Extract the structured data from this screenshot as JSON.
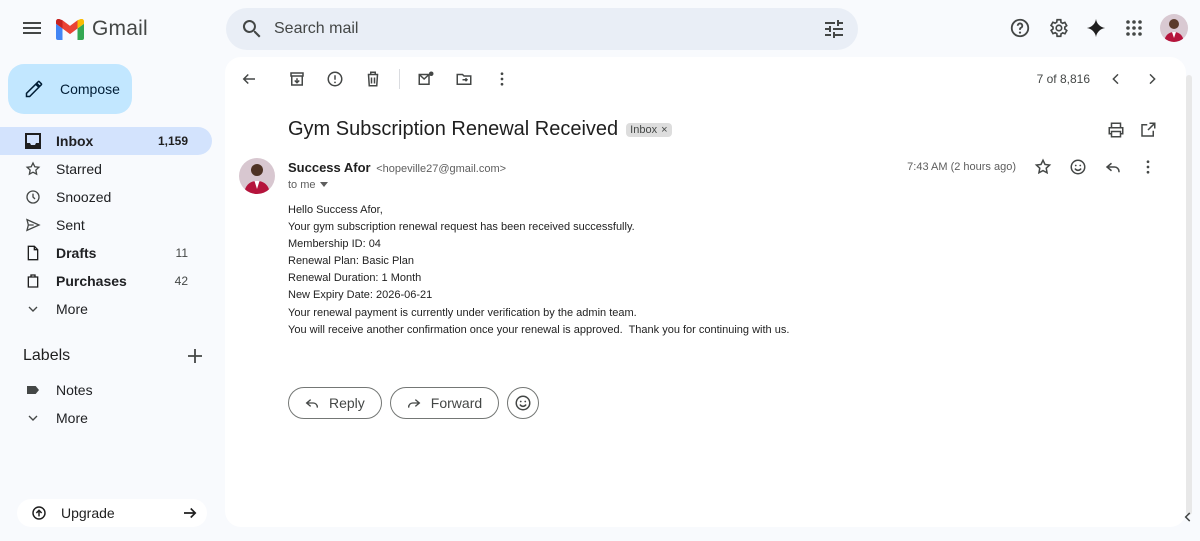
{
  "app": {
    "name": "Gmail",
    "search_placeholder": "Search mail"
  },
  "sidebar": {
    "compose_label": "Compose",
    "items": [
      {
        "label": "Inbox",
        "count": "1,159",
        "icon": "inbox-icon",
        "active": true
      },
      {
        "label": "Starred",
        "count": "",
        "icon": "star-icon"
      },
      {
        "label": "Snoozed",
        "count": "",
        "icon": "clock-icon"
      },
      {
        "label": "Sent",
        "count": "",
        "icon": "send-icon"
      },
      {
        "label": "Drafts",
        "count": "11",
        "icon": "draft-icon"
      },
      {
        "label": "Purchases",
        "count": "42",
        "icon": "purchases-icon"
      },
      {
        "label": "More",
        "count": "",
        "icon": "chevron-down-icon"
      }
    ],
    "labels_heading": "Labels",
    "labels": [
      {
        "label": "Notes",
        "icon": "label-icon"
      },
      {
        "label": "More",
        "icon": "chevron-down-icon"
      }
    ],
    "upgrade_label": "Upgrade"
  },
  "toolbar": {
    "pager_text": "7 of 8,816"
  },
  "email": {
    "subject": "Gym Subscription Renewal Received",
    "chip_label": "Inbox",
    "chip_close": "×",
    "sender_name": "Success Afor",
    "sender_email": "<hopeville27@gmail.com>",
    "to_line": "to me",
    "time": "7:43 AM (2 hours ago)",
    "body": [
      "Hello Success Afor,",
      "Your gym subscription renewal request has been received successfully.",
      "Membership ID: 04",
      "Renewal Plan: Basic Plan",
      "Renewal Duration: 1 Month",
      "New Expiry Date: 2026-06-21",
      "Your renewal payment is currently under verification by the admin team.",
      "You will receive another confirmation once your renewal is approved.  Thank you for continuing with us."
    ],
    "reply_label": "Reply",
    "forward_label": "Forward"
  },
  "colors": {
    "compose_bg": "#c2e7ff",
    "active_nav_bg": "#d3e3fd",
    "search_bg": "#e9eef6",
    "page_bg": "#f8fafd"
  }
}
